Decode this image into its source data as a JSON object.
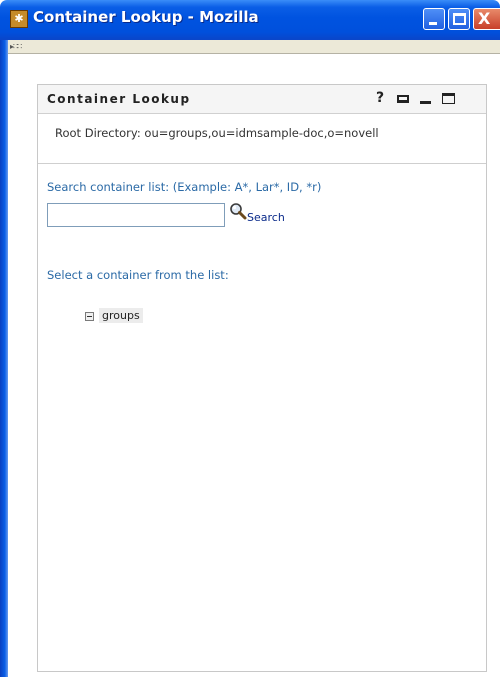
{
  "window": {
    "title": "Container Lookup - Mozilla",
    "app_icon": "mozilla-app-icon",
    "controls": {
      "minimize": "minimize-icon",
      "maximize": "maximize-icon",
      "close_glyph": "X"
    }
  },
  "portlet": {
    "title": "Container Lookup",
    "header_icons": {
      "help": "?",
      "print": "print-icon",
      "minimize": "minimize-icon",
      "maximize": "maximize-icon"
    },
    "root_directory": "Root Directory: ou=groups,ou=idmsample-doc,o=novell",
    "search": {
      "label": "Search container list: (Example: A*, Lar*, ID, *r)",
      "input_value": "",
      "button_label": "Search",
      "icon": "magnifier-icon"
    },
    "select_label": "Select a container from the list:",
    "tree": [
      {
        "label": "groups",
        "expanded": true
      }
    ]
  },
  "colors": {
    "titlebar": "#0053e0",
    "link_text": "#2b6aa6",
    "search_link": "#0a2a8a",
    "close_button": "#c8402a"
  }
}
